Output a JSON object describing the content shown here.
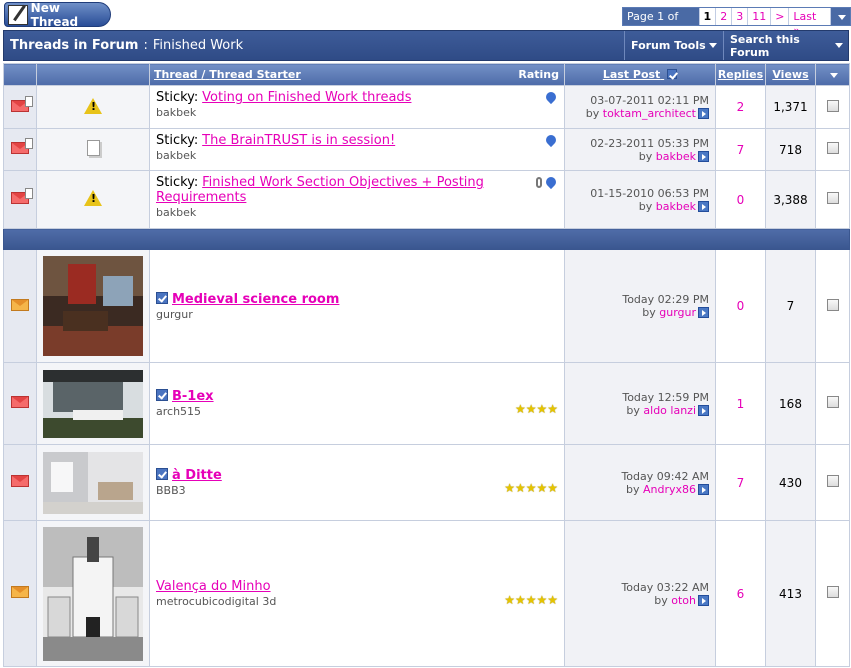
{
  "toolbar": {
    "new_thread_label": "New Thread"
  },
  "pager": {
    "info": "Page 1 of 26",
    "current": "1",
    "pages": [
      "2",
      "3",
      "11"
    ],
    "next": ">",
    "last": "Last »"
  },
  "forum": {
    "prefix": "Threads in Forum",
    "separator": ":",
    "name": "Finished Work",
    "tools_label": "Forum Tools",
    "search_label": "Search this Forum"
  },
  "columns": {
    "thread": "Thread",
    "slash": "/",
    "starter": "Thread Starter",
    "rating": "Rating",
    "last_post": "Last Post",
    "replies": "Replies",
    "views": "Views"
  },
  "sticky_prefix": "Sticky:",
  "sticky": [
    {
      "title": "Voting on Finished Work threads",
      "starter": "bakbek",
      "date": "03-07-2011",
      "time": "02:11 PM",
      "by": "by",
      "last_user": "toktam_architect",
      "replies": "2",
      "views": "1,371",
      "icon": "warning-icon"
    },
    {
      "title": "The BrainTRUST is in session!",
      "starter": "bakbek",
      "date": "02-23-2011",
      "time": "05:33 PM",
      "by": "by",
      "last_user": "bakbek",
      "replies": "7",
      "views": "718",
      "icon": "note-icon"
    },
    {
      "title": "Finished Work Section Objectives + Posting Requirements",
      "starter": "bakbek",
      "date": "01-15-2010",
      "time": "06:53 PM",
      "by": "by",
      "last_user": "bakbek",
      "replies": "0",
      "views": "3,388",
      "icon": "warning-icon"
    }
  ],
  "threads": [
    {
      "title": "Medieval science room",
      "starter": "gurgur",
      "date": "Today",
      "time": "02:29 PM",
      "by": "by",
      "last_user": "gurgur",
      "replies": "0",
      "views": "7",
      "stars": ""
    },
    {
      "title": "B-1ex",
      "starter": "arch515",
      "date": "Today",
      "time": "12:59 PM",
      "by": "by",
      "last_user": "aldo lanzi",
      "replies": "1",
      "views": "168",
      "stars": "★★★★"
    },
    {
      "title": "à Ditte",
      "starter": "BBB3",
      "date": "Today",
      "time": "09:42 AM",
      "by": "by",
      "last_user": "Andryx86",
      "replies": "7",
      "views": "430",
      "stars": "★★★★★"
    },
    {
      "title": "Valença do Minho",
      "starter": "metrocubicodigital 3d",
      "date": "Today",
      "time": "03:22 AM",
      "by": "by",
      "last_user": "otoh",
      "replies": "6",
      "views": "413",
      "stars": "★★★★★"
    }
  ]
}
